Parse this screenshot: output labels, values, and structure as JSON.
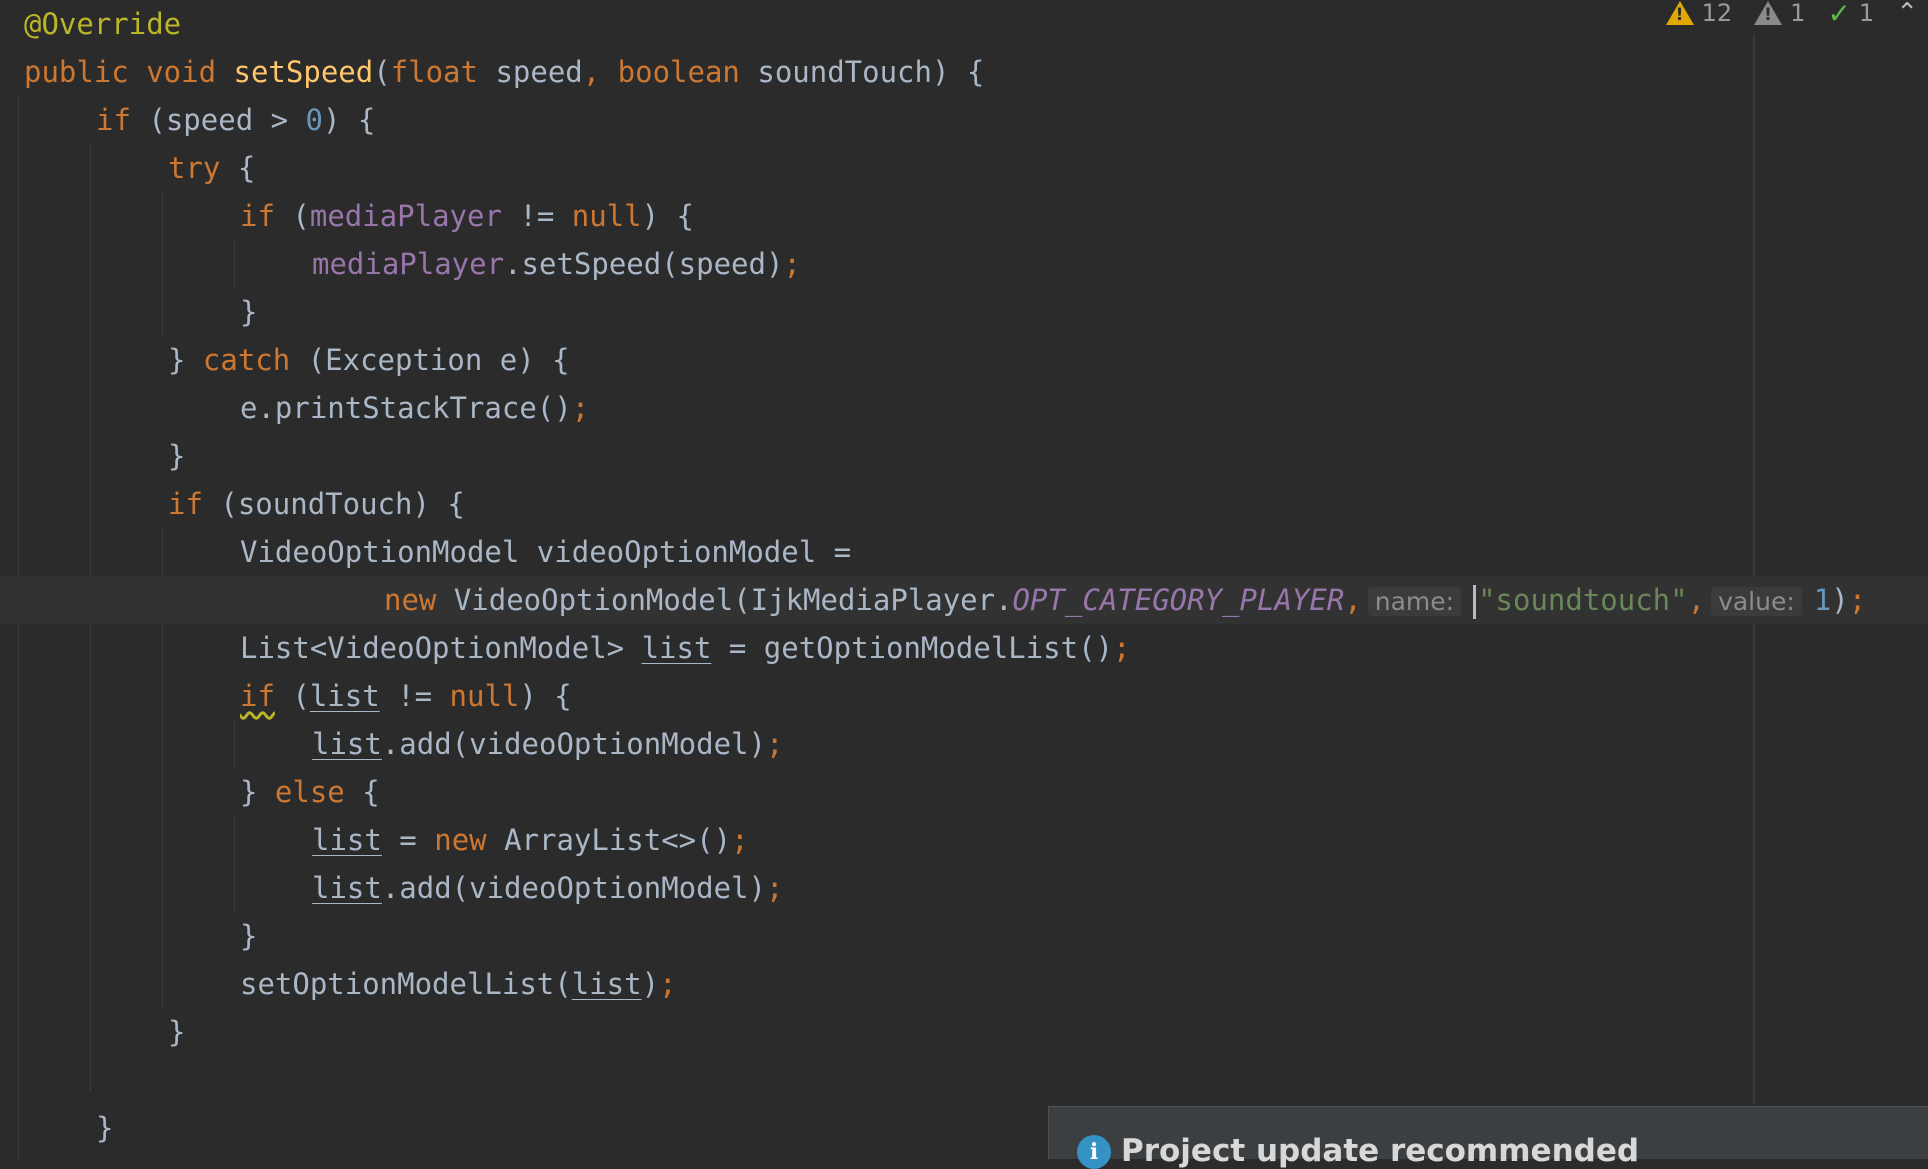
{
  "inspections": {
    "warnings": "12",
    "weak_warnings": "1",
    "typos": "1",
    "colors": {
      "warning": "#e0a800",
      "weak": "#8a8a8a",
      "ok": "#5fb84d"
    }
  },
  "notification": {
    "title": "Project update recommended",
    "icon": "info-icon"
  },
  "editor": {
    "theme_colors": {
      "background": "#2b2b2b",
      "keyword": "#cc7832",
      "method": "#ffc66d",
      "field": "#9876aa",
      "number": "#6897bb",
      "string": "#6a8759",
      "annotation": "#bbb529",
      "text": "#a9b7c6"
    },
    "lines": [
      {
        "indent": 0,
        "tokens": [
          {
            "t": "@Override",
            "c": "a"
          }
        ]
      },
      {
        "indent": 0,
        "tokens": [
          {
            "t": "public void ",
            "c": "k"
          },
          {
            "t": "setSpeed",
            "c": "f"
          },
          {
            "t": "("
          },
          {
            "t": "float ",
            "c": "k"
          },
          {
            "t": "speed"
          },
          {
            "t": ", ",
            "c": "k"
          },
          {
            "t": "boolean ",
            "c": "k"
          },
          {
            "t": "soundTouch) {"
          }
        ]
      },
      {
        "indent": 1,
        "tokens": [
          {
            "t": "if ",
            "c": "k"
          },
          {
            "t": "(speed > "
          },
          {
            "t": "0",
            "c": "n"
          },
          {
            "t": ") {"
          }
        ]
      },
      {
        "indent": 2,
        "tokens": [
          {
            "t": "try ",
            "c": "k"
          },
          {
            "t": "{"
          }
        ]
      },
      {
        "indent": 3,
        "tokens": [
          {
            "t": "if ",
            "c": "k"
          },
          {
            "t": "("
          },
          {
            "t": "mediaPlayer",
            "c": "fld"
          },
          {
            "t": " != "
          },
          {
            "t": "null",
            "c": "k"
          },
          {
            "t": ") {"
          }
        ]
      },
      {
        "indent": 4,
        "tokens": [
          {
            "t": "mediaPlayer",
            "c": "fld"
          },
          {
            "t": ".setSpeed(speed)"
          },
          {
            "t": ";",
            "c": "k"
          }
        ]
      },
      {
        "indent": 3,
        "tokens": [
          {
            "t": "}"
          }
        ]
      },
      {
        "indent": 2,
        "tokens": [
          {
            "t": "} "
          },
          {
            "t": "catch ",
            "c": "k"
          },
          {
            "t": "(Exception e) {"
          }
        ]
      },
      {
        "indent": 3,
        "tokens": [
          {
            "t": "e.printStackTrace()"
          },
          {
            "t": ";",
            "c": "k"
          }
        ]
      },
      {
        "indent": 2,
        "tokens": [
          {
            "t": "}"
          }
        ]
      },
      {
        "indent": 2,
        "tokens": [
          {
            "t": "if ",
            "c": "k"
          },
          {
            "t": "(soundTouch) {"
          }
        ]
      },
      {
        "indent": 3,
        "tokens": [
          {
            "t": "VideoOptionModel videoOptionModel ="
          }
        ]
      },
      {
        "indent": 5,
        "current": true,
        "tokens": [
          {
            "t": "new ",
            "c": "k"
          },
          {
            "t": "VideoOptionModel(IjkMediaPlayer."
          },
          {
            "t": "OPT_CATEGORY_PLAYER",
            "c": "cst"
          },
          {
            "t": ",",
            "c": "k"
          },
          {
            "t": "name:",
            "c": "h"
          },
          {
            "t": "",
            "c": "c"
          },
          {
            "t": "\"soundtouch\"",
            "c": "s"
          },
          {
            "t": ",",
            "c": "k"
          },
          {
            "t": "value:",
            "c": "h"
          },
          {
            "t": "1",
            "c": "n"
          },
          {
            "t": ")"
          },
          {
            "t": ";",
            "c": "k"
          }
        ]
      },
      {
        "indent": 3,
        "tokens": [
          {
            "t": "List<VideoOptionModel> "
          },
          {
            "t": "list",
            "c": "u"
          },
          {
            "t": " = getOptionModelList()"
          },
          {
            "t": ";",
            "c": "k"
          }
        ]
      },
      {
        "indent": 3,
        "tokens": [
          {
            "t": "if",
            "c": "k w"
          },
          {
            "t": " ("
          },
          {
            "t": "list",
            "c": "u"
          },
          {
            "t": " != "
          },
          {
            "t": "null",
            "c": "k"
          },
          {
            "t": ") {"
          }
        ]
      },
      {
        "indent": 4,
        "tokens": [
          {
            "t": "list",
            "c": "u"
          },
          {
            "t": ".add(videoOptionModel)"
          },
          {
            "t": ";",
            "c": "k"
          }
        ]
      },
      {
        "indent": 3,
        "tokens": [
          {
            "t": "} "
          },
          {
            "t": "else ",
            "c": "k"
          },
          {
            "t": "{"
          }
        ]
      },
      {
        "indent": 4,
        "tokens": [
          {
            "t": "list",
            "c": "u"
          },
          {
            "t": " = "
          },
          {
            "t": "new ",
            "c": "k"
          },
          {
            "t": "ArrayList<>()"
          },
          {
            "t": ";",
            "c": "k"
          }
        ]
      },
      {
        "indent": 4,
        "tokens": [
          {
            "t": "list",
            "c": "u"
          },
          {
            "t": ".add(videoOptionModel)"
          },
          {
            "t": ";",
            "c": "k"
          }
        ]
      },
      {
        "indent": 3,
        "tokens": [
          {
            "t": "}"
          }
        ]
      },
      {
        "indent": 3,
        "tokens": [
          {
            "t": "setOptionModelList("
          },
          {
            "t": "list",
            "c": "u"
          },
          {
            "t": ")"
          },
          {
            "t": ";",
            "c": "k"
          }
        ]
      },
      {
        "indent": 2,
        "tokens": [
          {
            "t": "}"
          }
        ]
      },
      {
        "indent": 0,
        "tokens": []
      },
      {
        "indent": 1,
        "tokens": [
          {
            "t": "}"
          }
        ]
      }
    ]
  }
}
